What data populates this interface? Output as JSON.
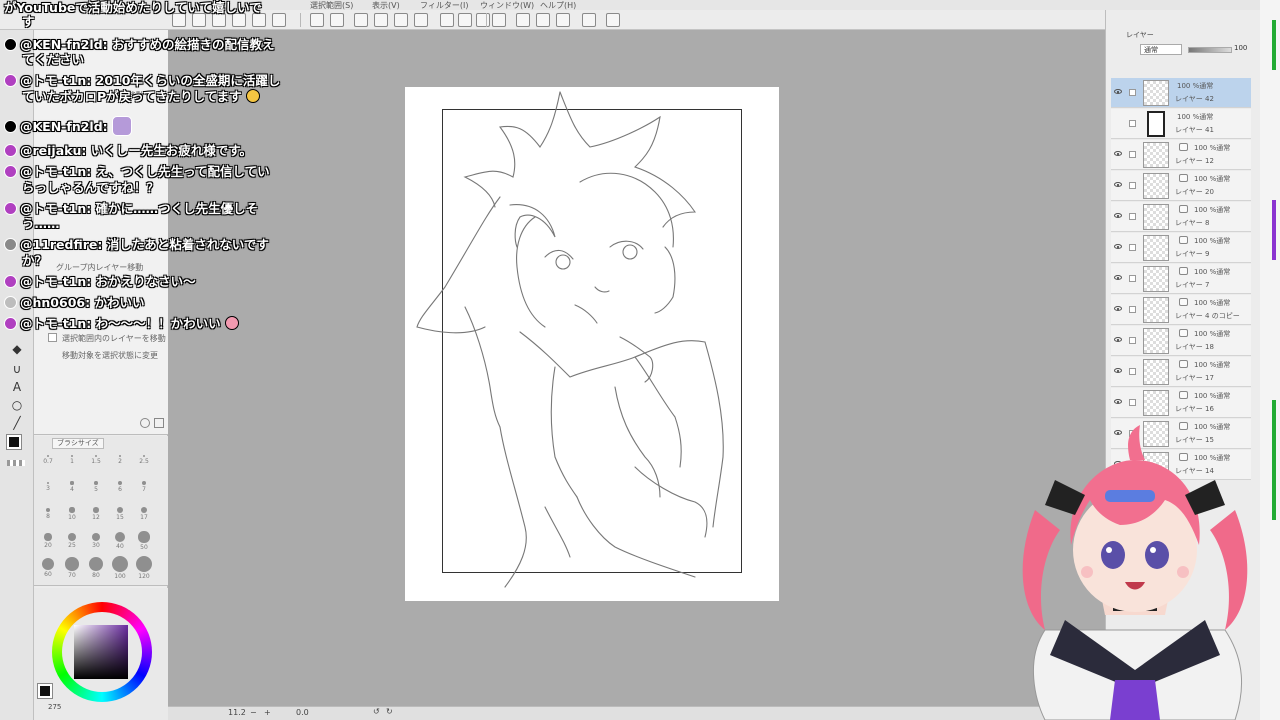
{
  "menubar": {
    "items": [
      "選択範囲(S)",
      "表示(V)",
      "フィルター(I)",
      "ウィンドウ(W)",
      "ヘルプ(H)"
    ]
  },
  "layers": {
    "tab_label": "レイヤー",
    "blend_mode": "通常",
    "opacity": "100",
    "rows": [
      {
        "mode": "100 %通常",
        "name": "レイヤー 42",
        "selected": true
      },
      {
        "mode": "100 %通常",
        "name": "レイヤー 41",
        "selected": false
      },
      {
        "mode": "100 %通常",
        "name": "レイヤー 12",
        "selected": false
      },
      {
        "mode": "100 %通常",
        "name": "レイヤー 20",
        "selected": false
      },
      {
        "mode": "100 %通常",
        "name": "レイヤー 8",
        "selected": false
      },
      {
        "mode": "100 %通常",
        "name": "レイヤー 9",
        "selected": false
      },
      {
        "mode": "100 %通常",
        "name": "レイヤー 7",
        "selected": false
      },
      {
        "mode": "100 %通常",
        "name": "レイヤー 4 のコピー",
        "selected": false
      },
      {
        "mode": "100 %通常",
        "name": "レイヤー 18",
        "selected": false
      },
      {
        "mode": "100 %通常",
        "name": "レイヤー 17",
        "selected": false
      },
      {
        "mode": "100 %通常",
        "name": "レイヤー 16",
        "selected": false
      },
      {
        "mode": "100 %通常",
        "name": "レイヤー 15",
        "selected": false
      },
      {
        "mode": "100 %通常",
        "name": "レイヤー 14",
        "selected": false
      }
    ]
  },
  "tool_property": {
    "options": [
      "選択範囲内のレイヤーを移動",
      "移動対象を選択状態に変更"
    ],
    "panel_labels": [
      "レイヤー移動",
      "グループ内レイヤー移動"
    ]
  },
  "brush_size": {
    "tab_label": "ブラシサイズ",
    "sizes": [
      "0.7",
      "1",
      "1.5",
      "2",
      "2.5",
      "3",
      "4",
      "5",
      "6",
      "7",
      "8",
      "10",
      "12",
      "15",
      "17",
      "20",
      "25",
      "30",
      "40",
      "50",
      "60",
      "70",
      "80",
      "100",
      "120"
    ]
  },
  "color": {
    "foreground": "#111111",
    "status_zoom": "275"
  },
  "canvas": {
    "zoom": "11.2",
    "angle": "0.0"
  },
  "chat": [
    {
      "user": "",
      "text": "がYouTubeで活動始めたりしていて嬉しいです",
      "avatar_color": "#000000"
    },
    {
      "user": "@KEN-fn2ld:",
      "text": "おすすめの絵描きの配信教えてください",
      "avatar_color": "#000000"
    },
    {
      "user": "@トモ-t1n:",
      "text": "2010年くらいの全盛期に活躍していたボカロPが戻ってきたりしてます😊",
      "avatar_color": "#b040c0"
    },
    {
      "user": "@KEN-fn2ld:",
      "text": "",
      "avatar_color": "#000000"
    },
    {
      "user": "@reijaku:",
      "text": "いくしー先生お疲れ様です。",
      "avatar_color": "#b040c0"
    },
    {
      "user": "@トモ-t1n:",
      "text": "え、つくし先生って配信していらっしゃるんですね！？",
      "avatar_color": "#b040c0"
    },
    {
      "user": "@トモ-t1n:",
      "text": "確かに……つくし先生優しそう……",
      "avatar_color": "#b040c0"
    },
    {
      "user": "@11redfire:",
      "text": "消したあと粘着されないですか？",
      "avatar_color": "#8a8a8a"
    },
    {
      "user": "@トモ-t1n:",
      "text": "おかえりなさい〜",
      "avatar_color": "#b040c0"
    },
    {
      "user": "@hn0606:",
      "text": "かわいい",
      "avatar_color": "#bdbdbd"
    },
    {
      "user": "@トモ-t1n:",
      "text": "わ〜〜〜！！かわいい🥰",
      "avatar_color": "#b040c0"
    }
  ],
  "chat_wrapped": {
    "line0_a": "がYouTubeで活動始めたりしていて嬉しいで",
    "line0_b": "す",
    "line1_a": "おすすめの絵描きの配信教え",
    "line1_b": "てください",
    "line2_a": "2010年くらいの全盛期に活躍し",
    "line2_b": "ていたボカロPが戻ってきたりしてます",
    "line5_a": "え、つくし先生って配信してい",
    "line5_b": "らっしゃるんですね！？",
    "line6_a": "確かに……つくし先生優しそ",
    "line6_b": "う……",
    "line7_a": "消したあと粘着されないです",
    "line7_b": "か？",
    "line10": "わ〜〜〜！！かわいい"
  }
}
